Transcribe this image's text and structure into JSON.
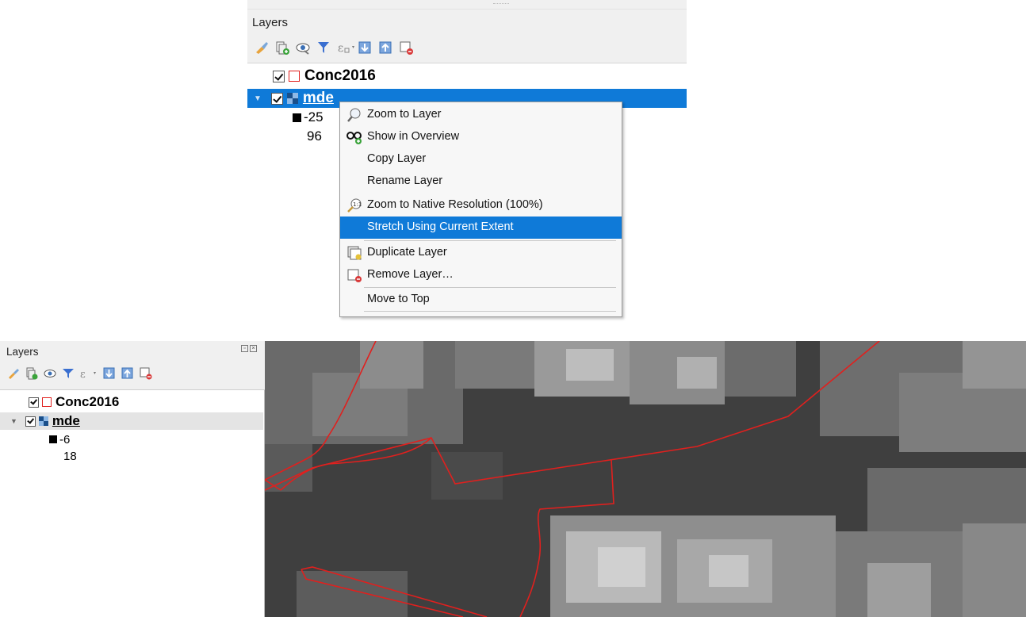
{
  "top_panel": {
    "title": "Layers",
    "layers": [
      {
        "name": "Conc2016",
        "checked": true,
        "type": "polygon"
      },
      {
        "name": "mde",
        "checked": true,
        "type": "raster",
        "selected": true
      }
    ],
    "legend": {
      "min": "-25",
      "max": "96"
    },
    "context_menu": {
      "items": [
        {
          "label": "Zoom to Layer",
          "icon": "zoom-layer-icon"
        },
        {
          "label": "Show in Overview",
          "icon": "overview-icon"
        },
        {
          "label": "Copy Layer",
          "icon": ""
        },
        {
          "label": "Rename Layer",
          "icon": ""
        },
        {
          "label": "Zoom to Native Resolution (100%)",
          "icon": "zoom-native-icon"
        },
        {
          "label": "Stretch Using Current Extent",
          "icon": "",
          "highlighted": true
        },
        {
          "label": "Duplicate Layer",
          "icon": "duplicate-layer-icon"
        },
        {
          "label": "Remove Layer…",
          "icon": "remove-layer-icon"
        },
        {
          "label": "Move to Top",
          "icon": ""
        }
      ]
    }
  },
  "bottom_panel": {
    "title": "Layers",
    "layers": [
      {
        "name": "Conc2016",
        "checked": true,
        "type": "polygon"
      },
      {
        "name": "mde",
        "checked": true,
        "type": "raster",
        "selected": true
      }
    ],
    "legend": {
      "min": "-6",
      "max": "18"
    }
  },
  "colors": {
    "selection": "#0f7ad8",
    "polygon_outline": "#e0201e",
    "map_background": "#3f3f3f"
  },
  "toolbar_icons": [
    "style-brush-icon",
    "add-group-icon",
    "visibility-eye-icon",
    "filter-icon",
    "expression-filter-icon",
    "expand-all-icon",
    "collapse-all-icon",
    "remove-layer-icon"
  ]
}
